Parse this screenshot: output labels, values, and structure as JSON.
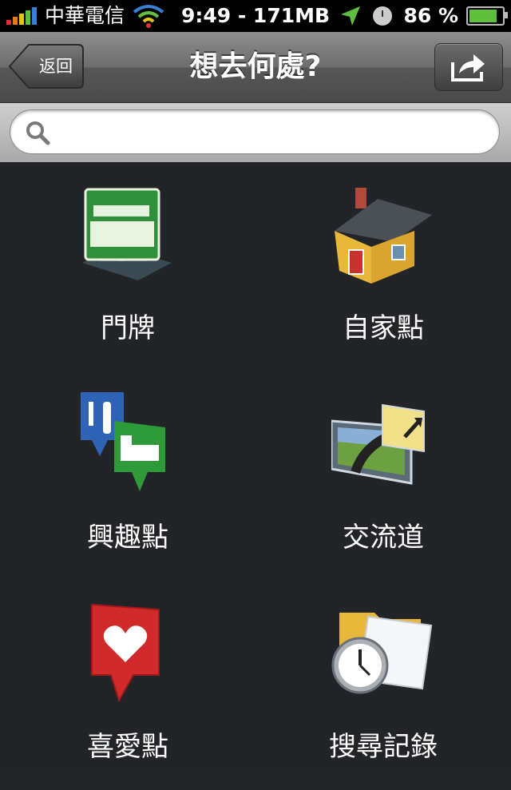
{
  "status_bar": {
    "carrier": "中華電信",
    "center_text": "9:49 - 171MB",
    "battery_percent": "86 %",
    "battery_level": 0.86,
    "icons": [
      "signal-bars-icon",
      "wifi-icon",
      "location-arrow-icon",
      "clock-icon",
      "battery-charging-icon"
    ]
  },
  "nav": {
    "title": "想去何處?",
    "back_label": "返回",
    "share_icon": "share-icon"
  },
  "search": {
    "value": "",
    "placeholder": "",
    "icon": "magnifier-icon"
  },
  "grid": {
    "items": [
      {
        "label": "門牌",
        "icon": "address-sign-icon"
      },
      {
        "label": "自家點",
        "icon": "house-icon"
      },
      {
        "label": "興趣點",
        "icon": "poi-restaurant-hotel-icon"
      },
      {
        "label": "交流道",
        "icon": "highway-exit-icon"
      },
      {
        "label": "喜愛點",
        "icon": "heart-pin-icon"
      },
      {
        "label": "搜尋記錄",
        "icon": "history-folder-clock-icon"
      }
    ]
  },
  "colors": {
    "background": "#232528",
    "nav_top": "#8e8e8e",
    "nav_bottom": "#4a4a4a",
    "text": "#ffffff"
  }
}
